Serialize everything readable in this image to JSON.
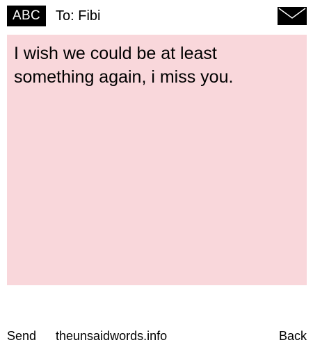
{
  "header": {
    "mode_badge": "ABC",
    "to_label": "To: Fibi",
    "envelope_icon": "envelope-icon"
  },
  "message": {
    "text": "I wish we could be at least something again, i miss you.",
    "background_color": "#f9d7db"
  },
  "footer": {
    "send_label": "Send",
    "site_label": "theunsaidwords.info",
    "back_label": "Back"
  }
}
